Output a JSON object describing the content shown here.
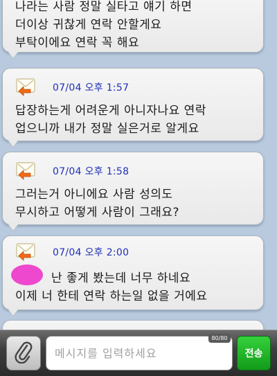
{
  "messages": [
    {
      "lines": [
        "나라는 사람 정말 실타고 얘기 하면",
        "더이상 귀찮게 연락 안할게요",
        "부탁이에요 연락 꼭 해요"
      ]
    },
    {
      "timestamp": "07/04 오후 1:57",
      "lines": [
        "답장하는게 어려운게 아니자나요 연락",
        "업으니까 내가 정말 실은거로 알게요"
      ]
    },
    {
      "timestamp": "07/04 오후 1:58",
      "lines": [
        "그러는거 아니에요 사람 성의도",
        "무시하고 어떻게 사람이 그래요?"
      ]
    },
    {
      "timestamp": "07/04 오후 2:00",
      "lines": [
        "난 좋게 봤는데 너무 하네요",
        "이제 너 한테 연락 하는일 없을 거에요"
      ]
    }
  ],
  "composer": {
    "placeholder": "메시지를 입력하세요",
    "counter": "80/80",
    "send_label": "전송"
  },
  "icons": {
    "message": "envelope-reply-icon",
    "attach": "paperclip-icon"
  },
  "colors": {
    "timestamp": "#1f2fb8",
    "send": "#1aa922",
    "redaction": "#ec3ecb"
  }
}
